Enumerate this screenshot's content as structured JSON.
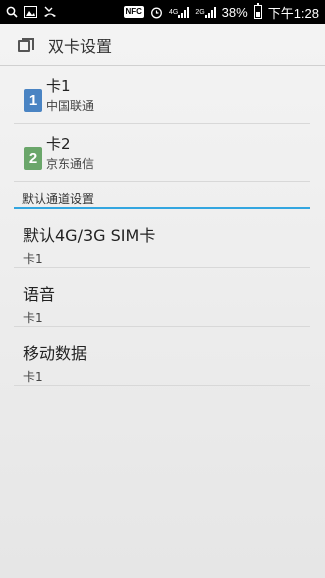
{
  "status_bar": {
    "net1": "4G",
    "net2": "2G",
    "battery": "38%",
    "time": "下午1:28",
    "nfc": "NFC"
  },
  "title": "双卡设置",
  "sims": [
    {
      "badge": "1",
      "name": "卡1",
      "carrier": "中国联通"
    },
    {
      "badge": "2",
      "name": "卡2",
      "carrier": "京东通信"
    }
  ],
  "section": "默认通道设置",
  "prefs": [
    {
      "title": "默认4G/3G SIM卡",
      "summary": "卡1"
    },
    {
      "title": "语音",
      "summary": "卡1"
    },
    {
      "title": "移动数据",
      "summary": "卡1"
    }
  ],
  "colors": {
    "accent": "#33a6e0",
    "sim1": "#4a84c3",
    "sim2": "#6aa66a"
  }
}
